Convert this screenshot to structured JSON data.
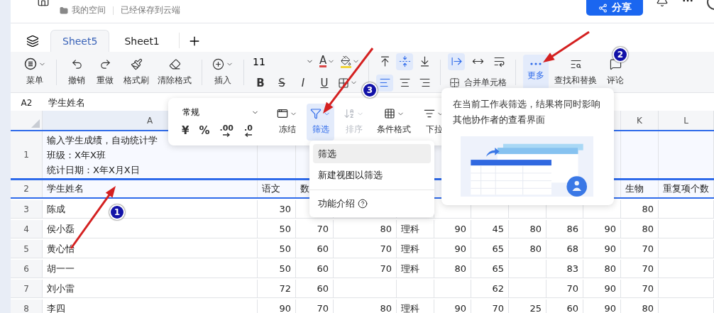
{
  "header": {
    "breadcrumb": "我的空间",
    "save_status": "已经保存到云端",
    "share_button": "分享"
  },
  "sheet_tabs": [
    {
      "label": "Sheet5",
      "selected": true
    },
    {
      "label": "Sheet1",
      "selected": false
    }
  ],
  "toolbar": {
    "menu": "菜单",
    "undo": "撤销",
    "redo": "重做",
    "format_painter": "格式刷",
    "clear_format": "清除格式",
    "insert": "插入",
    "font_size": "11",
    "font_color": "A",
    "text_style_buttons": [
      "B",
      "S",
      "I",
      "U"
    ],
    "align_buttons": [
      {
        "selected": false
      },
      {
        "selected": true
      },
      {
        "selected": false
      },
      {
        "selected": true
      },
      {
        "selected": false
      },
      {
        "selected": false
      }
    ],
    "wrap_buttons": [
      {
        "selected": true
      },
      {
        "selected": false
      },
      {
        "selected": false
      }
    ],
    "merge": "合并单元格",
    "more": {
      "label": "更多",
      "selected": true
    },
    "find_replace": "查找和替换",
    "comment": "评论"
  },
  "formula_bar": {
    "cell_ref": "A2",
    "value": "学生姓名"
  },
  "columns": [
    "A",
    null,
    null,
    null,
    null,
    null,
    null,
    null,
    null,
    null,
    "K",
    "L"
  ],
  "rows": [
    {
      "number": "1",
      "kind": "note",
      "selected": true,
      "lines": [
        "输入学生成绩，自动统计学",
        "班级：X年X班",
        "统计日期：X年X月X日"
      ]
    },
    {
      "number": "2",
      "kind": "header",
      "selected": true,
      "cells": [
        "学生姓名",
        "语文",
        "数",
        null,
        null,
        null,
        null,
        null,
        null,
        null,
        "生物",
        "重复项个数"
      ]
    },
    {
      "number": "3",
      "kind": "data",
      "selected": false,
      "cells": [
        "陈成",
        "30",
        null,
        null,
        null,
        null,
        null,
        null,
        null,
        null,
        "80",
        null
      ]
    },
    {
      "number": "4",
      "kind": "data",
      "selected": false,
      "cells": [
        "侯小磊",
        "50",
        "70",
        "80",
        "理科",
        "90",
        "45",
        "80",
        "86",
        "90",
        "80",
        null
      ]
    },
    {
      "number": "5",
      "kind": "data",
      "selected": false,
      "cells": [
        "黄心怡",
        "50",
        "60",
        "70",
        "理科",
        "90",
        "65",
        "80",
        "68",
        "90",
        "70",
        null
      ]
    },
    {
      "number": "6",
      "kind": "data",
      "selected": false,
      "cells": [
        "胡一一",
        "50",
        "60",
        "70",
        "理科",
        "80",
        "65",
        null,
        "83",
        "80",
        "70",
        null
      ]
    },
    {
      "number": "7",
      "kind": "data",
      "selected": false,
      "cells": [
        "刘小雷",
        "72",
        "60",
        null,
        null,
        null,
        "62",
        null,
        "70",
        "90",
        "70",
        null
      ]
    },
    {
      "number": "8",
      "kind": "data",
      "selected": false,
      "cells": [
        "李四",
        "90",
        "70",
        "80",
        "理科",
        "90",
        "70",
        "25",
        "60",
        "90",
        "80",
        null
      ]
    }
  ],
  "float_toolbar": {
    "number_format": "常规",
    "currency_buttons": [
      "¥",
      "%"
    ],
    "decimal_buttons": [
      ".00",
      ".0"
    ],
    "items": [
      {
        "label": "冻结",
        "selected": false,
        "disabled": false
      },
      {
        "label": "筛选",
        "selected": true,
        "disabled": false
      },
      {
        "label": "排序",
        "selected": false,
        "disabled": true
      },
      {
        "label": "条件格式",
        "selected": false,
        "disabled": false
      },
      {
        "label": "下拉",
        "selected": false,
        "disabled": false
      }
    ]
  },
  "filter_menu": {
    "items": [
      {
        "label": "筛选",
        "highlighted": true
      },
      {
        "label": "新建视图以筛选",
        "highlighted": false
      }
    ],
    "help": "功能介绍"
  },
  "tooltip": {
    "text": "在当前工作表筛选，结果将同时影响其他协作者的查看界面"
  },
  "annotations": {
    "markers": [
      "1",
      "2",
      "3"
    ]
  }
}
